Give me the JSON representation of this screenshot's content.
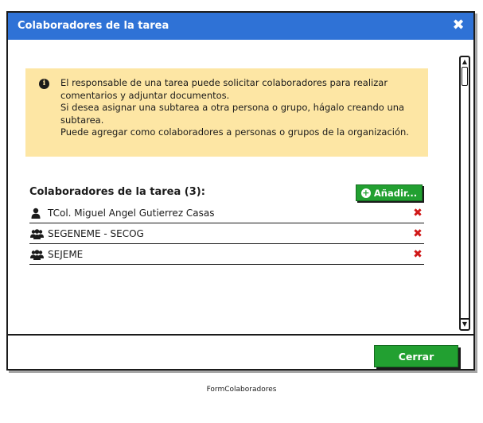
{
  "window": {
    "title": "Colaboradores de la tarea",
    "close_glyph": "✖"
  },
  "info": {
    "icon": "info-circle-icon",
    "lines": [
      "El responsable de una tarea puede solicitar colaboradores para realizar comentarios y adjuntar documentos.",
      "Si desea asignar una subtarea a otra persona o grupo, hágalo creando una subtarea.",
      "Puede agregar como colaboradores a personas o grupos de la organización."
    ]
  },
  "collaborators": {
    "title": "Colaboradores de la tarea (3):",
    "add_label": "Añadir...",
    "items": [
      {
        "label": "TCol. Miguel Angel Gutierrez Casas",
        "icon": "user-icon"
      },
      {
        "label": "SEGENEME - SECOG",
        "icon": "group-icon"
      },
      {
        "label": "SEJEME",
        "icon": "group-icon"
      }
    ]
  },
  "footer": {
    "close_label": "Cerrar"
  },
  "caption": "FormColaboradores",
  "colors": {
    "titlebar": "#2f72d6",
    "info_bg": "#fde6a4",
    "button": "#22a031",
    "remove": "#d01818"
  }
}
